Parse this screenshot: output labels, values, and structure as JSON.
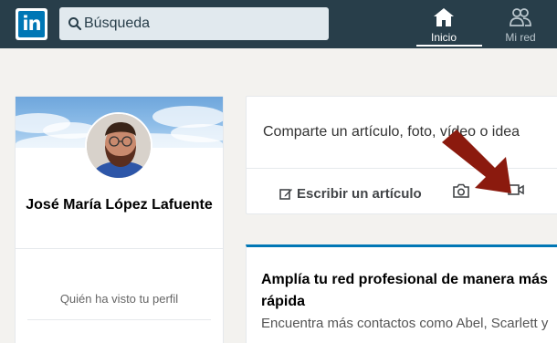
{
  "header": {
    "logo_text": "in",
    "search_placeholder": "Búsqueda",
    "nav": [
      {
        "label": "Inicio",
        "icon": "home-icon",
        "active": true
      },
      {
        "label": "Mi red",
        "icon": "people-icon",
        "active": false
      }
    ]
  },
  "profile": {
    "name": "José María López Lafuente",
    "stat_label": "Quién ha visto tu perfil"
  },
  "share": {
    "prompt": "Comparte un artículo, foto, vídeo o idea",
    "write_label": "Escribir un artículo",
    "photo_icon": "camera-icon",
    "video_icon": "video-icon"
  },
  "feed": {
    "title": "Amplía tu red profesional de manera más rápida",
    "subtitle": "Encuentra más contactos como Abel, Scarlett y"
  },
  "colors": {
    "topbar": "#283e4a",
    "brand": "#0077b5",
    "arrow": "#8b1a0e"
  }
}
